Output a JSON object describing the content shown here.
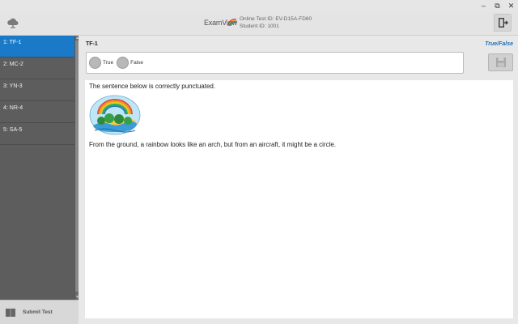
{
  "window": {
    "controls": [
      "–",
      "⧉",
      "✕"
    ]
  },
  "header": {
    "logo_main": "ExamView",
    "test_id": "Online Test ID: EV-D15A-FD60",
    "student_id": "Student ID: 1001",
    "icons": {
      "left": "cloud-icon",
      "right": "exit-door-icon"
    }
  },
  "sidebar": {
    "items": [
      {
        "label": "1: TF-1",
        "active": true
      },
      {
        "label": "2: MC-2",
        "active": false
      },
      {
        "label": "3: YN-3",
        "active": false
      },
      {
        "label": "4: NR-4",
        "active": false
      },
      {
        "label": "5: SA-5",
        "active": false
      }
    ],
    "submit_label": "Submit Test"
  },
  "question": {
    "label": "TF-1",
    "type": "True/False",
    "options": [
      "True",
      "False"
    ],
    "stem": "The sentence below is correctly punctuated.",
    "sentence": "From the ground, a rainbow looks like an arch, but from an aircraft, it might be a circle."
  },
  "colors": {
    "accent": "#1a7ac8",
    "sidebar_bg": "#5d5d5d",
    "type_label": "#1a6fc0"
  }
}
